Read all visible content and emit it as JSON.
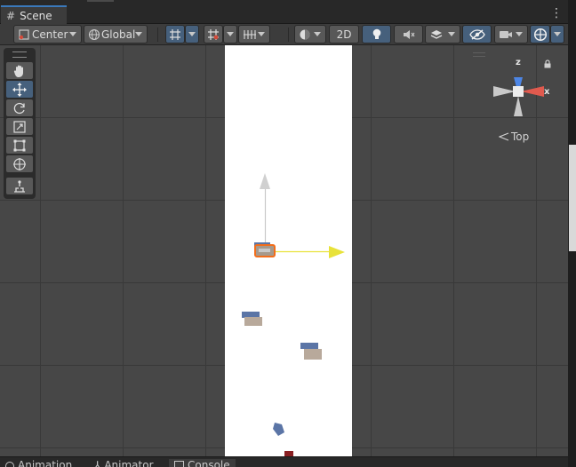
{
  "window": {
    "tab_title": "Scene"
  },
  "toolbar": {
    "pivot_label": "Center",
    "space_label": "Global",
    "mode_2d_label": "2D"
  },
  "tool_palette": {
    "tools": [
      "hand-tool",
      "move-tool",
      "rotate-tool",
      "scale-tool",
      "rect-tool",
      "transform-tool",
      "custom-tool"
    ],
    "active": "move-tool"
  },
  "gizmo": {
    "axis_y_label": "z",
    "axis_x_label": "x",
    "view_label": "Top"
  },
  "bottom_tabs": {
    "animation": "Animation",
    "animator": "Animator",
    "console": "Console"
  },
  "colors": {
    "selection_outline": "#f26d1b",
    "move_handle_x": "#e8e23a",
    "gizmo_z": "#4d86e6",
    "gizmo_x": "#e05a4e"
  }
}
